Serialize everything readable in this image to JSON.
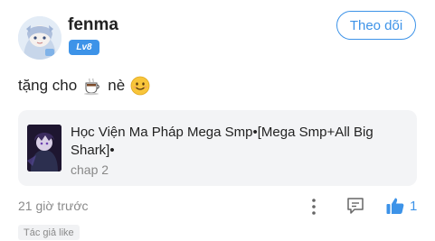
{
  "comment": {
    "username": "fenma",
    "level": "Lv8",
    "follow_label": "Theo dõi",
    "text": "tặng cho",
    "text_suffix": "nè",
    "emojis": [
      "coffee-emoji",
      "smile-emoji"
    ],
    "time": "21 giờ trước",
    "like_count": "1",
    "author_liked": "Tác giả like"
  },
  "story_card": {
    "title": "Học Viện Ma Pháp Mega Smp•[Mega Smp+All Big Shark]•",
    "chapter": "chap 2"
  },
  "colors": {
    "accent": "#3d93e8",
    "card_bg": "#f3f4f6",
    "muted_text": "#8a8a8a"
  }
}
